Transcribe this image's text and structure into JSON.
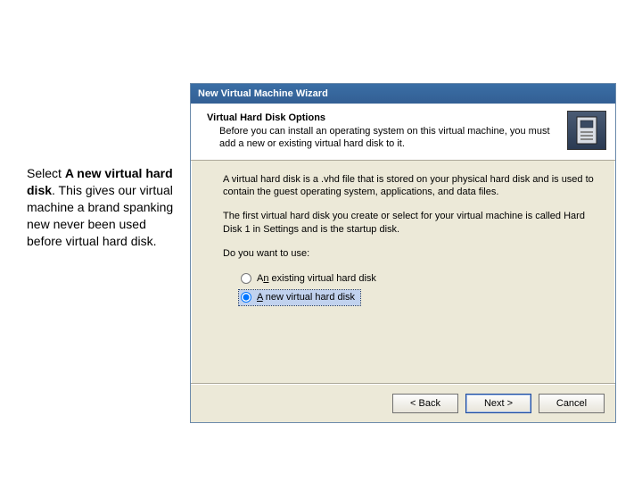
{
  "annotation": {
    "prefix": "Select ",
    "bold": "A new virtual hard disk",
    "suffix": ". This gives our virtual machine a brand spanking new never been used before virtual hard disk."
  },
  "wizard": {
    "title": "New Virtual Machine Wizard",
    "header_title": "Virtual Hard Disk Options",
    "header_sub": "Before you can install an operating system on this virtual machine, you must add a new or existing virtual hard disk to it.",
    "body_p1": "A virtual hard disk is a .vhd file that is stored on your physical hard disk and is used to contain the guest operating system, applications, and data files.",
    "body_p2": "The first virtual hard disk you create or select for your virtual machine is called Hard Disk 1 in Settings and is the startup disk.",
    "body_question": "Do you want to use:",
    "options": {
      "existing_prefix": "A",
      "existing_key": "n",
      "existing_rest": " existing virtual hard disk",
      "new": "A new virtual hard disk"
    },
    "buttons": {
      "back": "< Back",
      "next": "Next >",
      "cancel": "Cancel"
    }
  }
}
